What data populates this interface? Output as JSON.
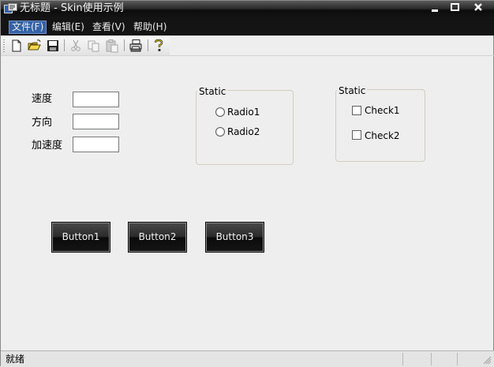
{
  "window": {
    "title": "无标题 - Skin使用示例",
    "app_icon": "mfc-app-icon",
    "controls": [
      "minimize-icon",
      "maximize-icon",
      "close-icon"
    ]
  },
  "menu": {
    "items": [
      {
        "label": "文件(F)",
        "active": true
      },
      {
        "label": "编辑(E)"
      },
      {
        "label": "查看(V)"
      },
      {
        "label": "帮助(H)"
      }
    ]
  },
  "toolbar": {
    "buttons": [
      "new-file-icon",
      "open-folder-icon",
      "save-icon",
      "cut-icon",
      "copy-icon",
      "paste-icon",
      "print-icon",
      "help-icon"
    ]
  },
  "form": {
    "fields": [
      {
        "label": "速度",
        "value": ""
      },
      {
        "label": "方向",
        "value": ""
      },
      {
        "label": "加速度",
        "value": ""
      }
    ]
  },
  "radio_group": {
    "caption": "Static",
    "options": [
      {
        "label": "Radio1",
        "checked": false
      },
      {
        "label": "Radio2",
        "checked": false
      }
    ]
  },
  "check_group": {
    "caption": "Static",
    "options": [
      {
        "label": "Check1",
        "checked": false
      },
      {
        "label": "Check2",
        "checked": false
      }
    ]
  },
  "buttons": [
    {
      "label": "Button1"
    },
    {
      "label": "Button2"
    },
    {
      "label": "Button3"
    }
  ],
  "status": {
    "text": "就绪"
  },
  "colors": {
    "skin_dark": "#141414",
    "menu_highlight": "#3562a6",
    "client_background": "#efeeee"
  }
}
